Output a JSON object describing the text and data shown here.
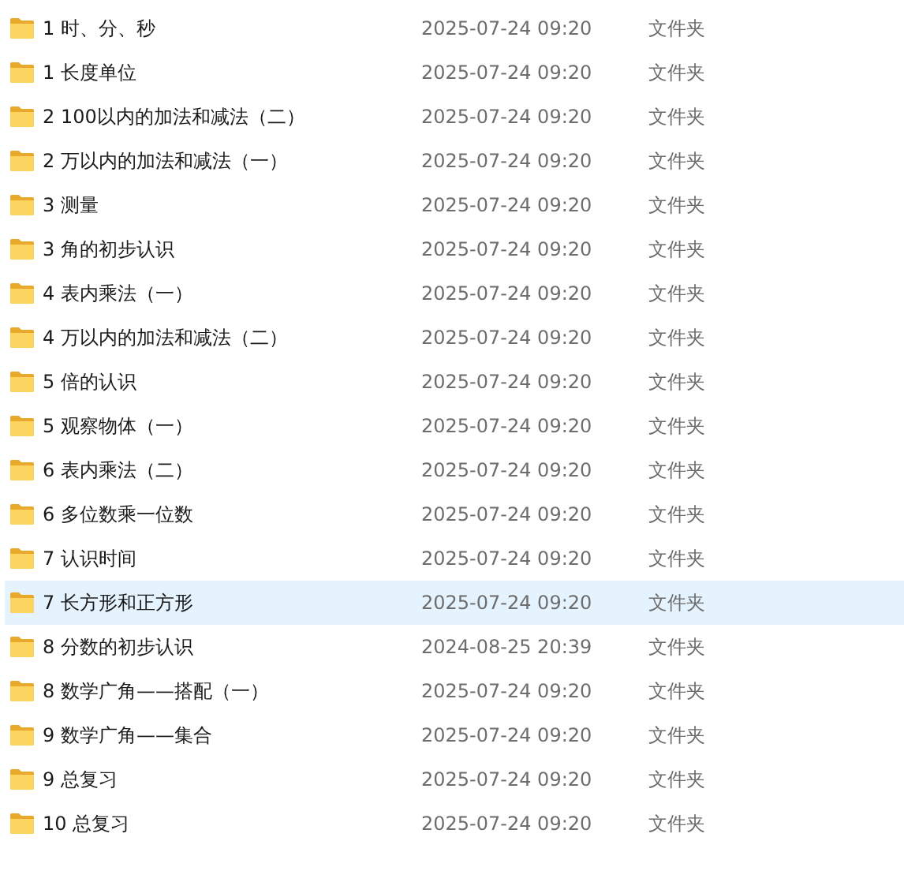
{
  "files": [
    {
      "name": "1 时、分、秒",
      "modified": "2025-07-24 09:20",
      "type": "文件夹",
      "selected": false
    },
    {
      "name": "1 长度单位",
      "modified": "2025-07-24 09:20",
      "type": "文件夹",
      "selected": false
    },
    {
      "name": "2 100以内的加法和减法（二）",
      "modified": "2025-07-24 09:20",
      "type": "文件夹",
      "selected": false
    },
    {
      "name": "2 万以内的加法和减法（一）",
      "modified": "2025-07-24 09:20",
      "type": "文件夹",
      "selected": false
    },
    {
      "name": "3 测量",
      "modified": "2025-07-24 09:20",
      "type": "文件夹",
      "selected": false
    },
    {
      "name": "3 角的初步认识",
      "modified": "2025-07-24 09:20",
      "type": "文件夹",
      "selected": false
    },
    {
      "name": "4 表内乘法（一）",
      "modified": "2025-07-24 09:20",
      "type": "文件夹",
      "selected": false
    },
    {
      "name": "4 万以内的加法和减法（二）",
      "modified": "2025-07-24 09:20",
      "type": "文件夹",
      "selected": false
    },
    {
      "name": "5 倍的认识",
      "modified": "2025-07-24 09:20",
      "type": "文件夹",
      "selected": false
    },
    {
      "name": "5 观察物体（一）",
      "modified": "2025-07-24 09:20",
      "type": "文件夹",
      "selected": false
    },
    {
      "name": "6 表内乘法（二）",
      "modified": "2025-07-24 09:20",
      "type": "文件夹",
      "selected": false
    },
    {
      "name": "6 多位数乘一位数",
      "modified": "2025-07-24 09:20",
      "type": "文件夹",
      "selected": false
    },
    {
      "name": "7 认识时间",
      "modified": "2025-07-24 09:20",
      "type": "文件夹",
      "selected": false
    },
    {
      "name": "7 长方形和正方形",
      "modified": "2025-07-24 09:20",
      "type": "文件夹",
      "selected": true
    },
    {
      "name": "8 分数的初步认识",
      "modified": "2024-08-25 20:39",
      "type": "文件夹",
      "selected": false
    },
    {
      "name": "8 数学广角——搭配（一）",
      "modified": "2025-07-24 09:20",
      "type": "文件夹",
      "selected": false
    },
    {
      "name": "9 数学广角——集合",
      "modified": "2025-07-24 09:20",
      "type": "文件夹",
      "selected": false
    },
    {
      "name": "9 总复习",
      "modified": "2025-07-24 09:20",
      "type": "文件夹",
      "selected": false
    },
    {
      "name": "10 总复习",
      "modified": "2025-07-24 09:20",
      "type": "文件夹",
      "selected": false
    }
  ]
}
